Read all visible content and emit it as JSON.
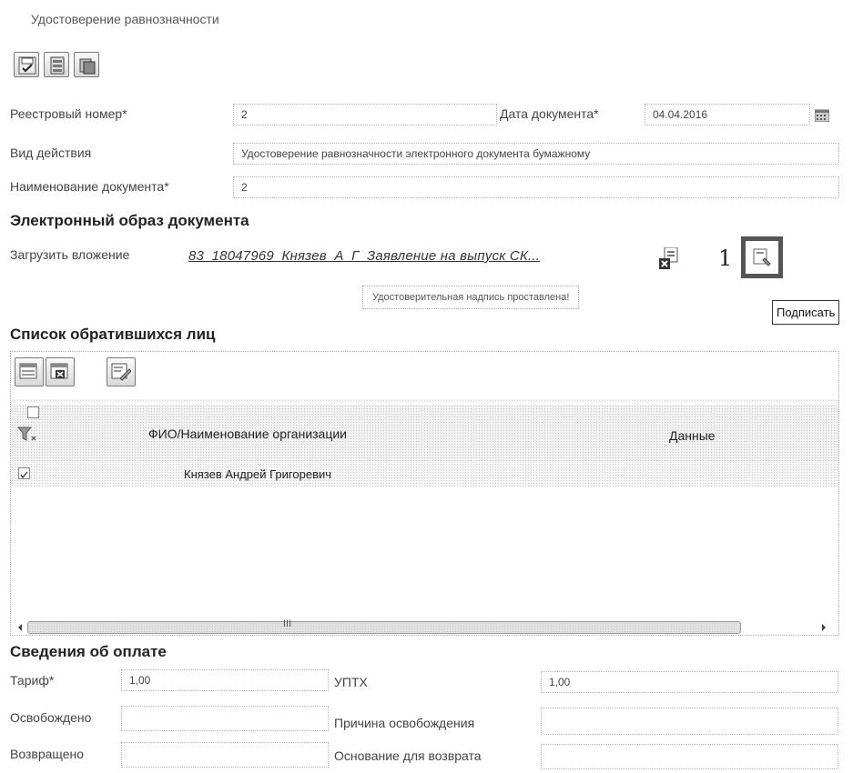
{
  "window": {
    "title": "Удостоверение равнозначности"
  },
  "toolbar": {
    "buttons": [
      {
        "name": "save-icon"
      },
      {
        "name": "save-close-icon"
      },
      {
        "name": "print-icon"
      }
    ]
  },
  "form": {
    "registry_number": {
      "label": "Реестровый номер*",
      "value": "2"
    },
    "document_date": {
      "label": "Дата документа*",
      "value": "04.04.2016"
    },
    "action_type": {
      "label": "Вид действия",
      "value": "Удостоверение равнозначности электронного документа бумажному"
    },
    "document_name": {
      "label": "Наименование документа*",
      "value": "2"
    }
  },
  "electronic_image": {
    "heading": "Электронный образ документа",
    "upload_label": "Загрузить вложение",
    "file_link": "83_18047969_Князев_А_Г_Заявление на выпуск СК...",
    "marker": "1",
    "notice": "Удостоверительная надпись проставлена!",
    "tooltip": "Подписать"
  },
  "applicants": {
    "heading": "Список обратившихся лиц",
    "columns": [
      "ФИО/Наименование организации",
      "Данные"
    ],
    "rows": [
      {
        "name": "Князев Андрей Григоревич",
        "data": "",
        "checked": true
      }
    ],
    "scroll_thumb": "III"
  },
  "payment": {
    "heading": "Сведения об оплате",
    "tariff": {
      "label": "Тариф*",
      "value": "1,00"
    },
    "upth": {
      "label": "УПТХ",
      "value": "1,00"
    },
    "exempted": {
      "label": "Освобождено",
      "value": ""
    },
    "exemption_reason": {
      "label": "Причина освобождения",
      "value": ""
    },
    "returned": {
      "label": "Возвращено",
      "value": ""
    },
    "return_basis": {
      "label": "Основание для возврата",
      "value": ""
    }
  },
  "colors": {
    "accent_border": "#555555",
    "field_border": "#b5b5b5"
  }
}
